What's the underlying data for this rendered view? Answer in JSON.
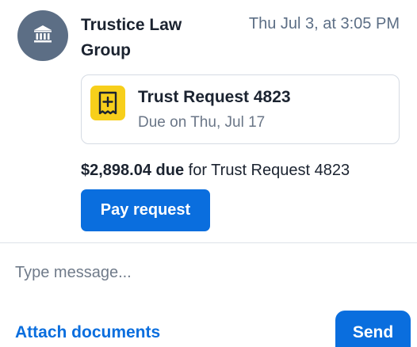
{
  "message": {
    "avatar_icon": "bank-building-icon",
    "sender": "Trustice Law Group",
    "timestamp": "Thu Jul 3, at 3:05 PM"
  },
  "request_card": {
    "icon": "receipt-plus-icon",
    "title": "Trust Request 4823",
    "due_label": "Due on Thu, Jul 17"
  },
  "due_line": {
    "amount": "$2,898.04 due",
    "rest": " for Trust Request 4823"
  },
  "pay_button": "Pay request",
  "composer": {
    "placeholder": "Type message...",
    "attach_label": "Attach documents",
    "send_label": "Send"
  },
  "colors": {
    "accent": "#0a6ede",
    "avatar_bg": "#5c6e85",
    "receipt_icon_bg": "#f7cf1b"
  }
}
